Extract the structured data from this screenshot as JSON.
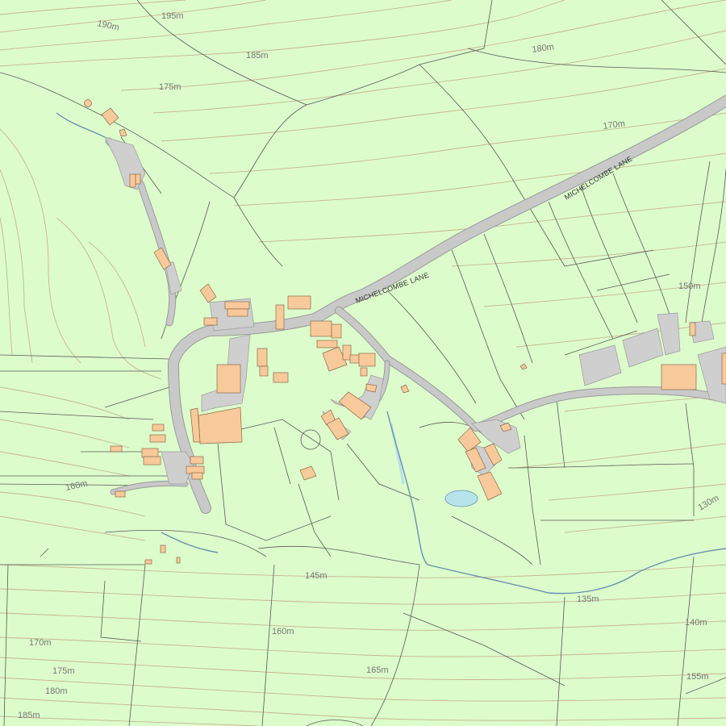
{
  "colors": {
    "land": "#dcfccb",
    "contour": "#c9b48e",
    "field_boundary": "#5a5a5a",
    "road": "#c9c9c9",
    "building": "#f8c99a",
    "water": "#b7e4ea",
    "stream": "#6b8fb3"
  },
  "road_labels": {
    "michelcombe_lane_1": "MICHELCOMBE LANE",
    "michelcombe_lane_2": "MICHELCOMBE LANE"
  },
  "height_labels": {
    "h195": "195m",
    "h190": "190m",
    "h185_top": "185m",
    "h180_top": "180m",
    "h175_top": "175m",
    "h170_ne": "170m",
    "h150_e": "150m",
    "h160_w": "160m",
    "h130_e": "130m",
    "h145": "145m",
    "h135": "135m",
    "h140_e": "140m",
    "h160_s": "160m",
    "h170_sw": "170m",
    "h175_sw": "175m",
    "h180_sw": "180m",
    "h185_sw": "185m",
    "h165_s": "165m",
    "h155_se": "155m"
  }
}
